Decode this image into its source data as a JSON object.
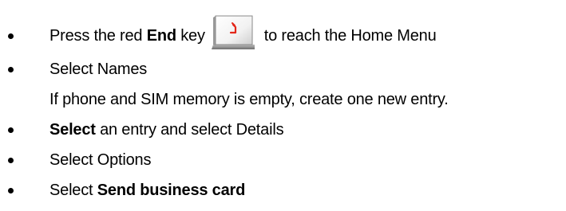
{
  "steps": [
    {
      "prefix": "Press the red ",
      "bold": "End",
      "mid": " key",
      "suffix": "to reach the Home Menu"
    },
    {
      "text": "Select Names"
    },
    {
      "note": "If phone and SIM memory is empty, create one new entry."
    },
    {
      "bold": "Select",
      "text": " an entry and select Details"
    },
    {
      "text": "Select Options"
    },
    {
      "text": "Select ",
      "bold": "Send business card"
    }
  ],
  "icons": {
    "end_key": "end-key-icon"
  },
  "colors": {
    "end_key_symbol": "#e3271a",
    "text": "#000000"
  }
}
